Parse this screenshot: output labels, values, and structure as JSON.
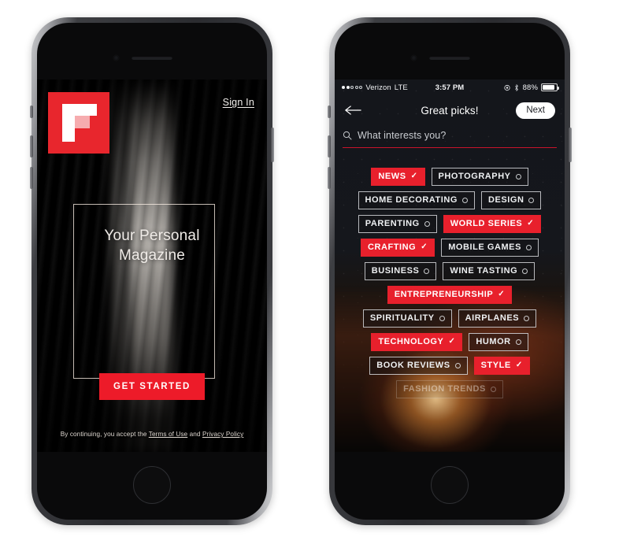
{
  "left_phone": {
    "brand_logo": "flipboard-logo",
    "sign_in_label": "Sign In",
    "hero_title_line1": "Your Personal",
    "hero_title_line2": "Magazine",
    "cta_label": "GET STARTED",
    "legal": {
      "prefix": "By continuing, you accept the ",
      "terms_label": "Terms of Use",
      "conjunction": " and ",
      "privacy_label": "Privacy Policy"
    },
    "accent_color": "#ed1b29"
  },
  "right_phone": {
    "status_bar": {
      "carrier": "Verizon",
      "network": "LTE",
      "time": "3:57 PM",
      "battery_percent": "88%",
      "signal_filled_dots": 2,
      "signal_hollow_dots": 3
    },
    "navbar": {
      "back_icon": "back-arrow-icon",
      "title": "Great picks!",
      "next_label": "Next"
    },
    "search": {
      "icon": "search-icon",
      "placeholder": "What interests you?",
      "underline_color": "#c8142b"
    },
    "tag_rows": [
      [
        {
          "label": "NEWS",
          "selected": true
        },
        {
          "label": "PHOTOGRAPHY",
          "selected": false
        }
      ],
      [
        {
          "label": "HOME DECORATING",
          "selected": false
        },
        {
          "label": "DESIGN",
          "selected": false
        }
      ],
      [
        {
          "label": "PARENTING",
          "selected": false
        },
        {
          "label": "WORLD SERIES",
          "selected": true
        }
      ],
      [
        {
          "label": "CRAFTING",
          "selected": true
        },
        {
          "label": "MOBILE GAMES",
          "selected": false
        }
      ],
      [
        {
          "label": "BUSINESS",
          "selected": false
        },
        {
          "label": "WINE TASTING",
          "selected": false
        }
      ],
      [
        {
          "label": "ENTREPRENEURSHIP",
          "selected": true
        }
      ],
      [
        {
          "label": "SPIRITUALITY",
          "selected": false
        },
        {
          "label": "AIRPLANES",
          "selected": false
        }
      ],
      [
        {
          "label": "TECHNOLOGY",
          "selected": true
        },
        {
          "label": "HUMOR",
          "selected": false
        }
      ],
      [
        {
          "label": "BOOK REVIEWS",
          "selected": false
        },
        {
          "label": "STYLE",
          "selected": true
        }
      ],
      [
        {
          "label": "FASHION TRENDS",
          "selected": false,
          "faded": true
        }
      ]
    ],
    "selected_mark": "✓",
    "unselected_mark": "circle",
    "accent_color": "#e8202c"
  }
}
